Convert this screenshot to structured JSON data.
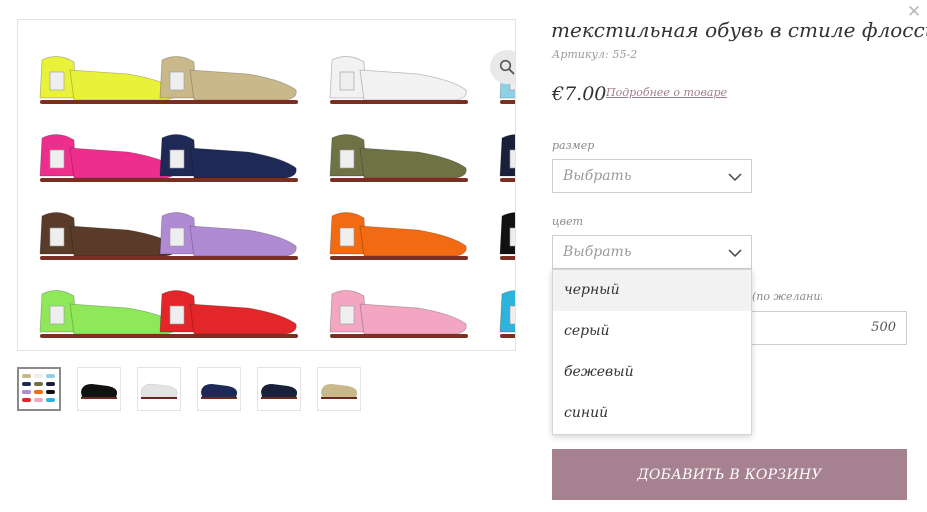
{
  "product": {
    "title": "текстильная обувь в стиле флосси",
    "sku_label": "Артикул:",
    "sku_value": "55-2",
    "price": "€7.00",
    "details_link": "Подробнее о товаре"
  },
  "size": {
    "label": "размер",
    "placeholder": "Выбрать"
  },
  "color": {
    "label": "цвет",
    "placeholder": "Выбрать",
    "options": [
      "черный",
      "серый",
      "бежевый",
      "синий"
    ]
  },
  "quantity": {
    "label_partial": "желанию)",
    "value": "500"
  },
  "cart": {
    "add_label": "ДОБАВИТЬ В КОРЗИНУ"
  },
  "gallery": {
    "thumb_colors": [
      "multi",
      "#111111",
      "#e8e8e8",
      "#1e2a55",
      "#1a1f3a",
      "#c8b88a"
    ],
    "shoe_colors": [
      [
        "#e8f23a",
        "#c8b88a",
        "#f2f2f2",
        "#8fd0e6"
      ],
      [
        "#ee2e8c",
        "#1e2a55",
        "#6f7244",
        "#1a1f3a"
      ],
      [
        "#5a3a28",
        "#b08ad2",
        "#f26a12",
        "#111111"
      ],
      [
        "#8ee85a",
        "#e2262a",
        "#f2a6c2",
        "#2db4dd"
      ]
    ]
  },
  "accent_colors": {
    "button": "#a68291",
    "link": "#a27d8d"
  },
  "icons": [
    "close-icon",
    "zoom-icon",
    "chevron-down-icon"
  ]
}
